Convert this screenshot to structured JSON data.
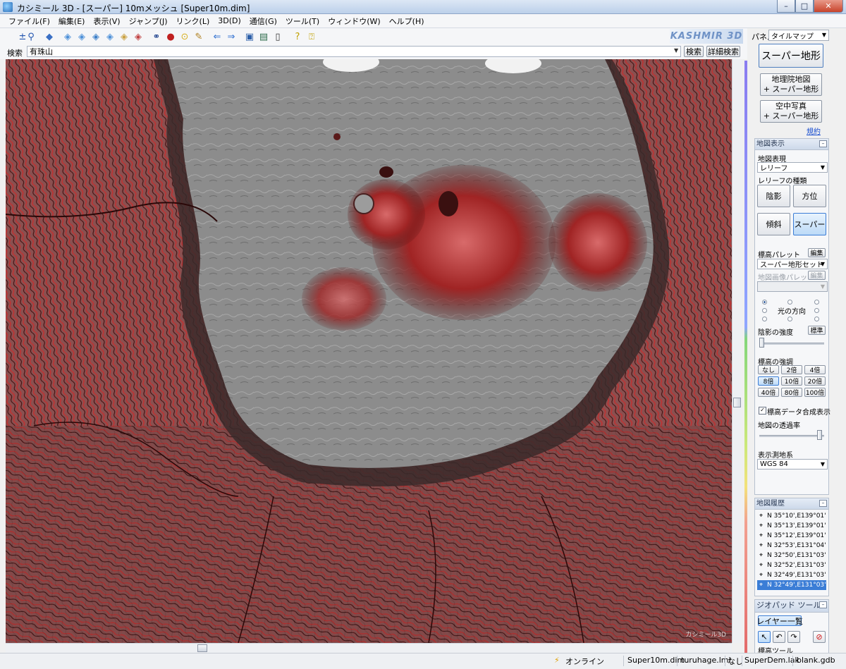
{
  "window": {
    "title": "カシミール 3D - [スーパー] 10mメッシュ [Super10m.dim]",
    "min": "–",
    "max": "□",
    "close": "✕"
  },
  "menu": [
    "ファイル(F)",
    "編集(E)",
    "表示(V)",
    "ジャンプ(J)",
    "リンク(L)",
    "3D(D)",
    "通信(G)",
    "ツール(T)",
    "ウィンドウ(W)",
    "ヘルプ(H)"
  ],
  "toolbar": {
    "logo": "KASHMIR 3D"
  },
  "search": {
    "label": "検索",
    "value": "有珠山",
    "search_button": "検索",
    "detail_button": "詳細検索"
  },
  "map": {
    "watermark": "カシミール3D"
  },
  "panel": {
    "label": "パネル",
    "panel_select": "タイルマップ",
    "super_button": "スーパー地形",
    "gsi_button": [
      "地理院地図",
      "+ スーパー地形"
    ],
    "aerial_button": [
      "空中写真",
      "+ スーパー地形"
    ],
    "terms_link": "規約",
    "map_display": {
      "header": "地図表示",
      "expression_label": "地図表現",
      "expression_value": "レリーフ",
      "relief_label": "レリーフの種類",
      "relief_buttons": [
        "陰影",
        "方位",
        "傾斜",
        "スーパー"
      ],
      "palette_label": "標高パレット",
      "palette_edit": "編集",
      "palette_value": "スーパー地形セット",
      "image_palette_label": "地図画像パレット",
      "image_palette_edit": "編集",
      "light_label": "光の方向",
      "shade_label": "陰影の強度",
      "shade_default": "標準",
      "emph_label": "標高の強調",
      "emph_buttons": [
        "なし",
        "2倍",
        "4倍",
        "8倍",
        "10倍",
        "20倍",
        "40倍",
        "80倍",
        "100倍"
      ],
      "emph_selected": "8倍",
      "composite_label": "標高データ合成表示",
      "transparency_label": "地図の透過率",
      "datum_label": "表示測地系",
      "datum_value": "WGS 84"
    },
    "history": {
      "header": "地図履歴",
      "items": [
        "N 35°10',E139°01'",
        "N 35°13',E139°01'",
        "N 35°12',E139°01'",
        "N 32°53',E131°04'",
        "N 32°50',E131°03'",
        "N 32°52',E131°03'",
        "N 32°49',E131°03'",
        "N 32°49',E131°03'"
      ]
    },
    "geopad": {
      "header": "ジオパッド ツール",
      "layers_button": "レイヤー一覧",
      "tools_label": "標高ツール"
    }
  },
  "status": {
    "online": "オンライン",
    "files": [
      "Super10m.dim",
      "turuhage.lml",
      "なし",
      "SuperDem.lak",
      "blank.gdb"
    ]
  },
  "colors": {
    "ridge": "#b02626",
    "ridge_dark": "#4a0e0e",
    "caldera_floor": "#8e8e8e",
    "accent": "#3b7dd6"
  }
}
